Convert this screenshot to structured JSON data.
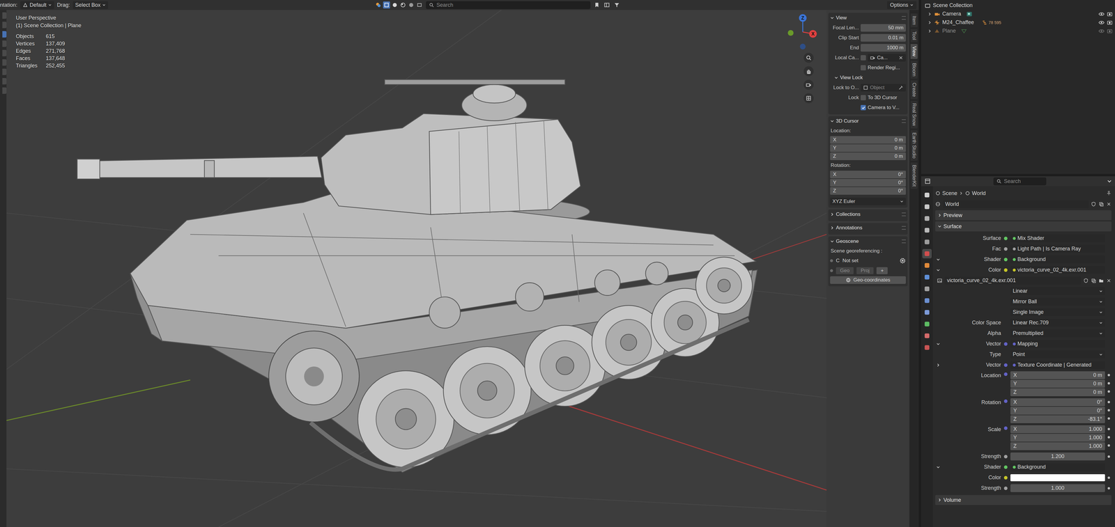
{
  "header": {
    "orientation_label": "ntation:",
    "orientation": "Default",
    "drag_label": "Drag:",
    "drag": "Select Box",
    "search": {
      "placeholder": "Search"
    },
    "options": "Options"
  },
  "viewport": {
    "title": "User Perspective",
    "context": "(1) Scene Collection | Plane",
    "stats": [
      {
        "label": "Objects",
        "value": "615"
      },
      {
        "label": "Vertices",
        "value": "137,409"
      },
      {
        "label": "Edges",
        "value": "271,768"
      },
      {
        "label": "Faces",
        "value": "137,648"
      },
      {
        "label": "Triangles",
        "value": "252,455"
      }
    ]
  },
  "gizmo": {
    "axes": [
      {
        "label": "Z",
        "color": "#3b74d6"
      },
      {
        "label": "X",
        "color": "#e0403f"
      }
    ]
  },
  "sidebar": {
    "tabs": [
      {
        "label": "Item",
        "selected": false
      },
      {
        "label": "Tool",
        "selected": false
      },
      {
        "label": "View",
        "selected": true
      },
      {
        "label": "Bloom",
        "selected": false
      },
      {
        "label": "Create",
        "selected": false
      },
      {
        "label": "Real Snow",
        "selected": false
      },
      {
        "label": "Earth Studio",
        "selected": false
      },
      {
        "label": "BlenderKit",
        "selected": false
      }
    ],
    "view": {
      "title": "View",
      "expanded": true,
      "fields": [
        {
          "label": "Focal Len...",
          "value": "50 mm"
        },
        {
          "label": "Clip Start",
          "value": "0.01 m"
        },
        {
          "label": "End",
          "value": "1000 m"
        }
      ],
      "local_camera": {
        "label": "Local Ca...",
        "checked": false,
        "value": "Ca..."
      },
      "render_region": {
        "label": "Render Regi...",
        "checked": false
      },
      "view_lock": {
        "title": "View Lock",
        "expanded": true,
        "lock_to_object": {
          "label": "Lock to O...",
          "placeholder": "Object"
        },
        "lock_label": "Lock",
        "options": [
          {
            "label": "To 3D Cursor",
            "checked": false
          },
          {
            "label": "Camera to V...",
            "checked": true
          }
        ]
      }
    },
    "cursor": {
      "title": "3D Cursor",
      "expanded": true,
      "location_label": "Location:",
      "location": [
        {
          "axis": "X",
          "value": "0 m"
        },
        {
          "axis": "Y",
          "value": "0 m"
        },
        {
          "axis": "Z",
          "value": "0 m"
        }
      ],
      "rotation_label": "Rotation:",
      "rotation": [
        {
          "axis": "X",
          "value": "0°"
        },
        {
          "axis": "Y",
          "value": "0°"
        },
        {
          "axis": "Z",
          "value": "0°"
        }
      ],
      "mode": "XYZ Euler"
    },
    "collapsed_panels": [
      {
        "title": "Collections",
        "expanded": false
      },
      {
        "title": "Annotations",
        "expanded": false
      }
    ],
    "geoscene": {
      "title": "Geoscene",
      "expanded": true,
      "label": "Scene georeferencing :",
      "crs_letter": "C",
      "crs_value": "Not set",
      "buttons": [
        {
          "label": "Geo",
          "disabled": true
        },
        {
          "label": "Proj",
          "disabled": true
        },
        {
          "label": "+",
          "disabled": false
        }
      ],
      "action": "Geo-coordinates"
    }
  },
  "outliner": {
    "root": "Scene Collection",
    "items": [
      {
        "name": "Camera",
        "kind": "camera",
        "badge": "",
        "hidden": false
      },
      {
        "name": "M24_Chaffee",
        "kind": "empty",
        "badge": "78 595",
        "hidden": false
      },
      {
        "name": "Plane",
        "kind": "mesh",
        "badge": "",
        "hidden": true
      }
    ]
  },
  "properties": {
    "search": {
      "placeholder": "Search"
    },
    "tabs": [
      {
        "color": "#d0d0d0",
        "selected": false
      },
      {
        "color": "#c8c8c8",
        "selected": false
      },
      {
        "color": "#b0b0b0",
        "selected": false
      },
      {
        "color": "#b8b8b8",
        "selected": false
      },
      {
        "color": "#9c9c9c",
        "selected": false
      },
      {
        "color": "#d24e4e",
        "selected": true
      },
      {
        "color": "#e08a3a",
        "selected": false
      },
      {
        "color": "#5f8fd6",
        "selected": false
      },
      {
        "color": "#a0a0a0",
        "selected": false
      },
      {
        "color": "#6b8fd0",
        "selected": false
      },
      {
        "color": "#7c9ad8",
        "selected": false
      },
      {
        "color": "#5dbb63",
        "selected": false
      },
      {
        "color": "#d46a6a",
        "selected": false
      },
      {
        "color": "#c85454",
        "selected": false
      }
    ],
    "breadcrumb": [
      "Scene",
      "World"
    ],
    "world": "World",
    "preview": {
      "title": "Preview",
      "expanded": false
    },
    "surface": {
      "title": "Surface",
      "expanded": true,
      "rows": [
        {
          "kind": "link",
          "label": "Surface",
          "value": "Mix Shader",
          "socket": "#63c763"
        },
        {
          "kind": "link",
          "label": "Fac",
          "value": "Light Path | Is Camera Ray",
          "socket": "#a1a1a1"
        },
        {
          "kind": "link",
          "label": "Shader",
          "value": "Background",
          "socket": "#63c763",
          "expanded": true
        },
        {
          "kind": "link",
          "label": "Color",
          "value": "victoria_curve_02_4k.exr.001",
          "socket": "#c7c729",
          "expanded": true
        },
        {
          "kind": "image",
          "value": "victoria_curve_02_4k.exr.001"
        },
        {
          "kind": "dropdown",
          "label": "",
          "value": "Linear"
        },
        {
          "kind": "dropdown",
          "label": "",
          "value": "Mirror Ball"
        },
        {
          "kind": "dropdown",
          "label": "",
          "value": "Single Image"
        },
        {
          "kind": "dropdown",
          "label": "Color Space",
          "value": "Linear Rec.709"
        },
        {
          "kind": "dropdown",
          "label": "Alpha",
          "value": "Premultiplied"
        },
        {
          "kind": "link",
          "label": "Vector",
          "value": "Mapping",
          "socket": "#6363c7",
          "expanded": true
        },
        {
          "kind": "dropdown",
          "label": "Type",
          "value": "Point"
        },
        {
          "kind": "link",
          "label": "Vector",
          "value": "Texture Coordinate | Generated",
          "socket": "#6363c7",
          "expanded": false
        },
        {
          "kind": "vector",
          "label": "Location",
          "socket": "#6363c7",
          "values": [
            {
              "axis": "X",
              "value": "0 m"
            },
            {
              "axis": "Y",
              "value": "0 m"
            },
            {
              "axis": "Z",
              "value": "0 m"
            }
          ]
        },
        {
          "kind": "vector",
          "label": "Rotation",
          "socket": "#6363c7",
          "values": [
            {
              "axis": "X",
              "value": "0°"
            },
            {
              "axis": "Y",
              "value": "0°"
            },
            {
              "axis": "Z",
              "value": "-83.1°"
            }
          ]
        },
        {
          "kind": "vector",
          "label": "Scale",
          "socket": "#6363c7",
          "values": [
            {
              "axis": "X",
              "value": "1.000"
            },
            {
              "axis": "Y",
              "value": "1.000"
            },
            {
              "axis": "Z",
              "value": "1.000"
            }
          ]
        },
        {
          "kind": "number",
          "label": "Strength",
          "value": "1.200",
          "socket": "#a1a1a1"
        },
        {
          "kind": "link",
          "label": "Shader",
          "value": "Background",
          "socket": "#63c763",
          "expanded": true
        },
        {
          "kind": "color",
          "label": "Color",
          "swatch": "#ffffff",
          "socket": "#c7c729"
        },
        {
          "kind": "number",
          "label": "Strength",
          "value": "1.000",
          "socket": "#a1a1a1"
        }
      ]
    },
    "volume": {
      "title": "Volume",
      "expanded": false
    }
  }
}
